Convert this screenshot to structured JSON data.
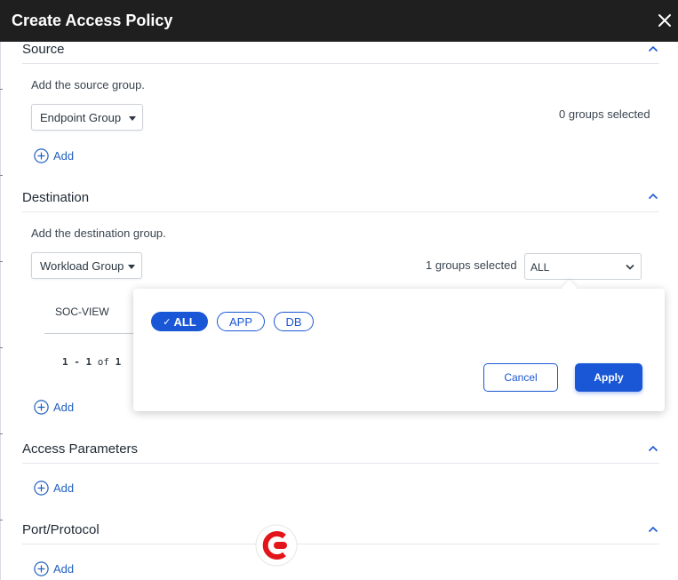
{
  "dialog": {
    "title": "Create Access Policy"
  },
  "source": {
    "title": "Source",
    "hint": "Add the source group.",
    "dropdown": "Endpoint Group",
    "count": "0 groups selected",
    "add": "Add"
  },
  "destination": {
    "title": "Destination",
    "hint": "Add the destination group.",
    "dropdown": "Workload Group",
    "count": "1 groups selected",
    "filter_value": "ALL",
    "table_header": "SOC-VIEW",
    "pager": {
      "from": "1",
      "sep": "-",
      "to": "1",
      "of": "of",
      "total": "1"
    },
    "add": "Add"
  },
  "filter_popover": {
    "pills": [
      {
        "label": "ALL",
        "selected": true
      },
      {
        "label": "APP",
        "selected": false
      },
      {
        "label": "DB",
        "selected": false
      }
    ],
    "cancel": "Cancel",
    "apply": "Apply"
  },
  "access_parameters": {
    "title": "Access Parameters",
    "add": "Add"
  },
  "port_protocol": {
    "title": "Port/Protocol",
    "add": "Add"
  },
  "colors": {
    "accent": "#1a57d6",
    "link": "#1f5fbf",
    "header_bg": "#1f1f1f",
    "logo": "#e3151a"
  }
}
